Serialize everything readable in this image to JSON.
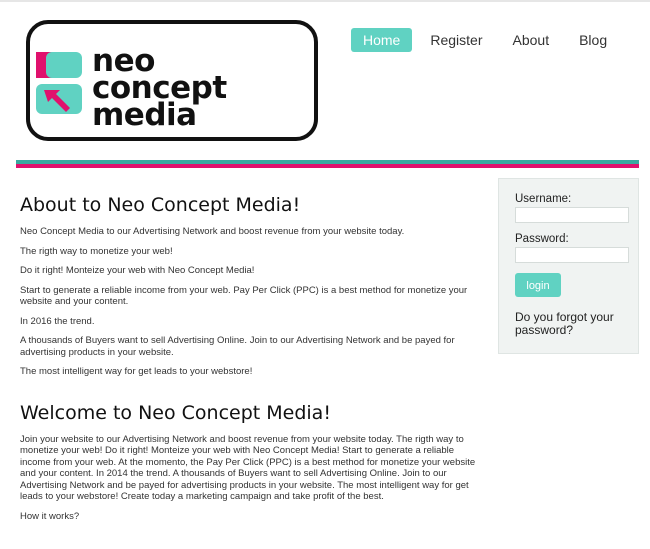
{
  "logo": {
    "line1": "neo",
    "line2": "concept",
    "line3": "media",
    "colors": {
      "teal": "#60d2c2",
      "pink": "#e0116d"
    }
  },
  "nav": {
    "items": [
      {
        "label": "Home",
        "active": true
      },
      {
        "label": "Register"
      },
      {
        "label": "About"
      },
      {
        "label": "Blog"
      }
    ]
  },
  "colors": {
    "accent": "#60d2c2",
    "stripe_teal": "#3aa9a0",
    "stripe_pink": "#e0116d"
  },
  "main": {
    "about": {
      "title": "About to Neo Concept Media!",
      "paragraphs": [
        "Neo Concept Media to our Advertising Network and boost revenue from your website today.",
        "The rigth way to monetize your web!",
        "Do it right! Monteize your web with Neo Concept Media!",
        "Start to generate a reliable income from your web. Pay Per Click (PPC) is a best method for monetize your website and your content.",
        "In 2016 the trend.",
        "A thousands of Buyers want to sell Advertising Online. Join to our Advertising Network and be payed for advertising products in your website.",
        "The most intelligent way for get leads to your webstore!"
      ]
    },
    "welcome": {
      "title": "Welcome to Neo Concept Media!",
      "body": "Join your website to our Advertising Network and boost revenue from your website today. The rigth way to monetize your web! Do it right! Monteize your web with Neo Concept Media! Start to generate a reliable income from your web. At the momento, the Pay Per Click (PPC) is a best method for monetize your website and your content. In 2014 the trend. A thousands of Buyers want to sell Advertising Online. Join to our Advertising Network and be payed for advertising products in your website. The most intelligent way for get leads to your webstore! Create today a marketing campaign and take profit of the best.",
      "how": "How it works?"
    }
  },
  "sidebar": {
    "username_label": "Username:",
    "username_value": "",
    "password_label": "Password:",
    "password_value": "",
    "login_label": "login",
    "forgot_text": "Do you forgot your password?"
  }
}
